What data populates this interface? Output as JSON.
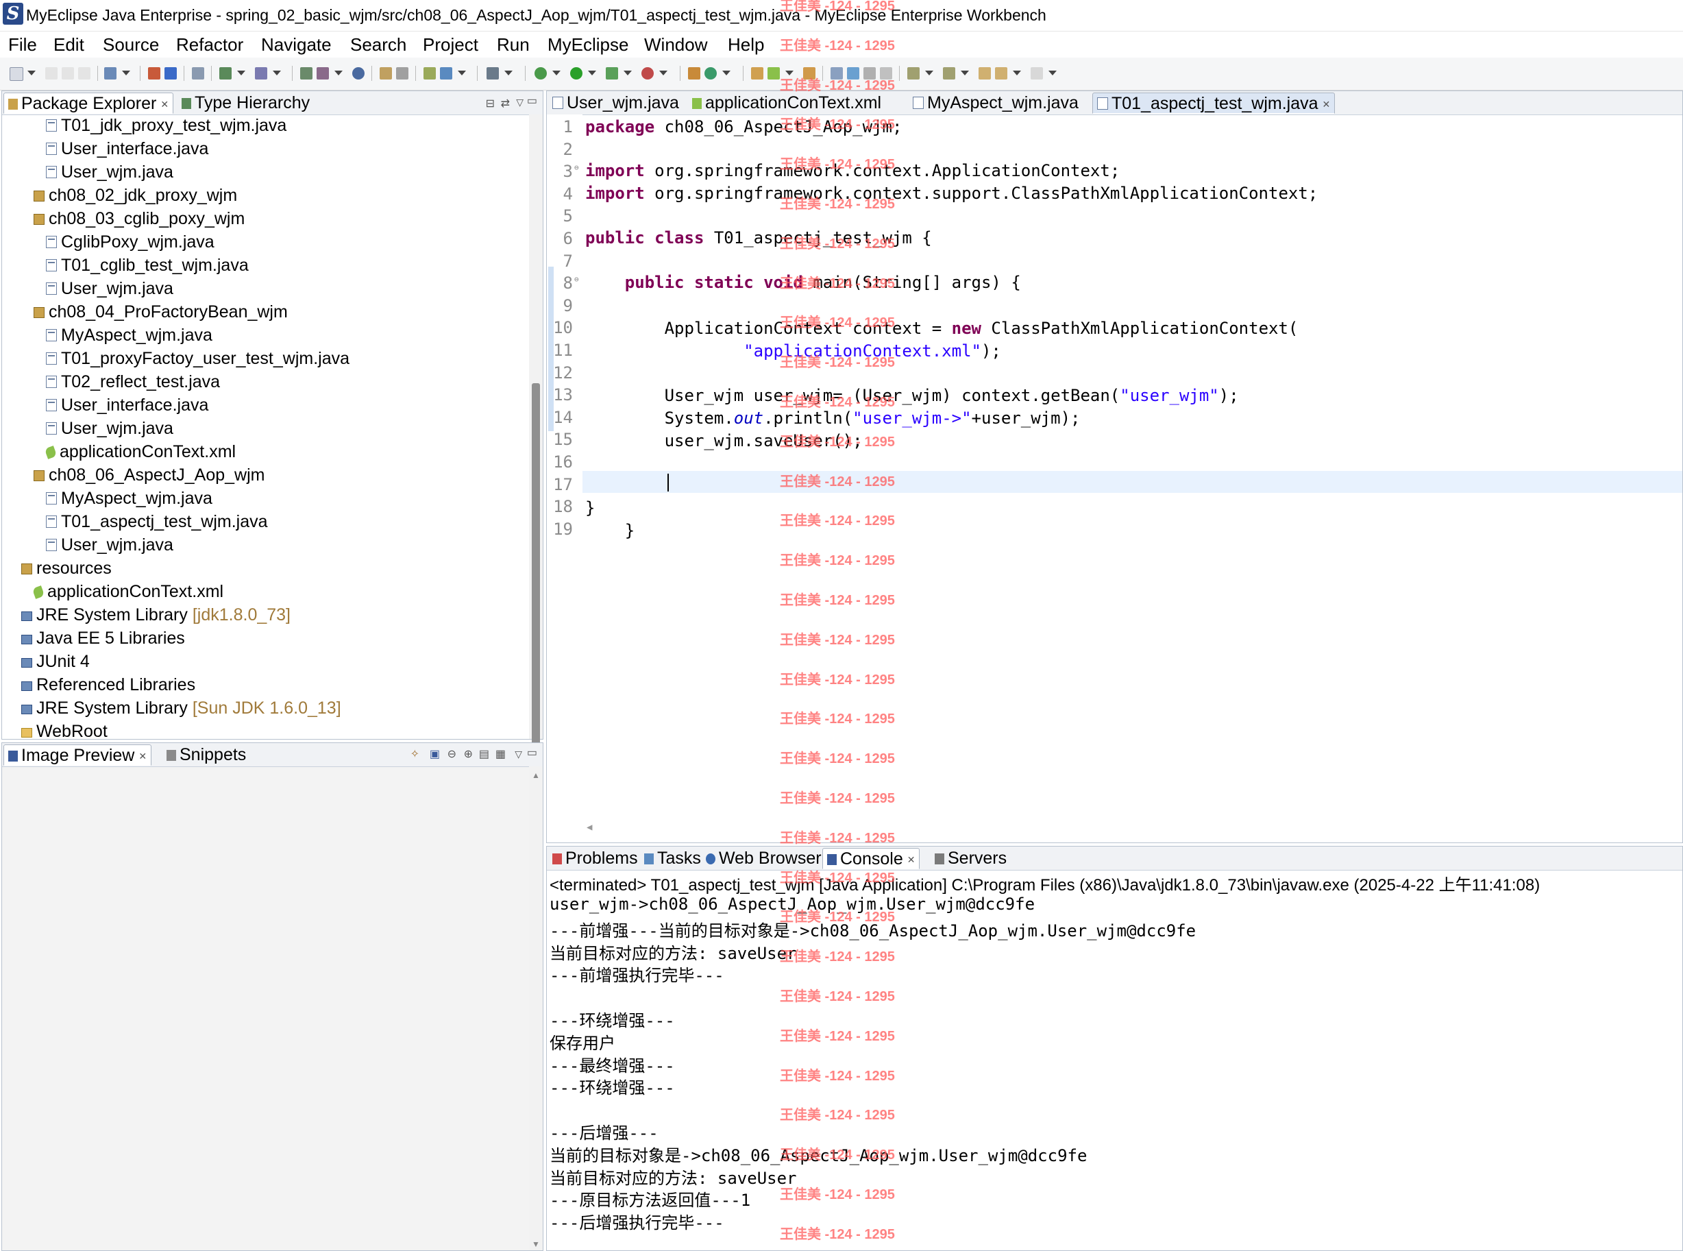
{
  "window": {
    "title": "MyEclipse Java Enterprise - spring_02_basic_wjm/src/ch08_06_AspectJ_Aop_wjm/T01_aspectj_test_wjm.java - MyEclipse Enterprise Workbench"
  },
  "menu": [
    "File",
    "Edit",
    "Source",
    "Refactor",
    "Navigate",
    "Search",
    "Project",
    "Run",
    "MyEclipse",
    "Window",
    "Help"
  ],
  "explorer": {
    "tabs": [
      "Package Explorer",
      "Type Hierarchy"
    ],
    "items": [
      {
        "label": "T01_jdk_proxy_test_wjm.java",
        "kind": "java-file-icon"
      },
      {
        "label": "User_interface.java",
        "kind": "java-file-icon"
      },
      {
        "label": "User_wjm.java",
        "kind": "java-file-icon"
      },
      {
        "label": "ch08_02_jdk_proxy_wjm",
        "kind": "package-icon"
      },
      {
        "label": "ch08_03_cglib_poxy_wjm",
        "kind": "package-icon"
      },
      {
        "label": "CglibPoxy_wjm.java",
        "kind": "java-file-icon"
      },
      {
        "label": "T01_cglib_test_wjm.java",
        "kind": "java-file-icon"
      },
      {
        "label": "User_wjm.java",
        "kind": "java-file-icon"
      },
      {
        "label": "ch08_04_ProFactoryBean_wjm",
        "kind": "package-icon"
      },
      {
        "label": "MyAspect_wjm.java",
        "kind": "java-file-icon"
      },
      {
        "label": "T01_proxyFactoy_user_test_wjm.java",
        "kind": "java-file-icon"
      },
      {
        "label": "T02_reflect_test.java",
        "kind": "java-file-icon"
      },
      {
        "label": "User_interface.java",
        "kind": "java-file-icon"
      },
      {
        "label": "User_wjm.java",
        "kind": "java-file-icon"
      },
      {
        "label": "applicationConText.xml",
        "kind": "xml-file-icon"
      },
      {
        "label": "ch08_06_AspectJ_Aop_wjm",
        "kind": "package-icon"
      },
      {
        "label": "MyAspect_wjm.java",
        "kind": "java-file-icon"
      },
      {
        "label": "T01_aspectj_test_wjm.java",
        "kind": "java-file-icon"
      },
      {
        "label": "User_wjm.java",
        "kind": "java-file-icon"
      },
      {
        "label": "resources",
        "kind": "package-icon"
      },
      {
        "label": "applicationConText.xml",
        "kind": "xml-file-icon"
      },
      {
        "label": "JRE System Library",
        "kind": "library-icon",
        "suffix": "[jdk1.8.0_73]"
      },
      {
        "label": "Java EE 5 Libraries",
        "kind": "library-icon"
      },
      {
        "label": "JUnit 4",
        "kind": "library-icon"
      },
      {
        "label": "Referenced Libraries",
        "kind": "library-icon"
      },
      {
        "label": "JRE System Library",
        "kind": "library-icon",
        "suffix": "[Sun JDK 1.6.0_13]"
      },
      {
        "label": "WebRoot",
        "kind": "folder-icon"
      }
    ]
  },
  "preview": {
    "tabs": [
      "Image Preview",
      "Snippets"
    ]
  },
  "editor": {
    "tabs": [
      "User_wjm.java",
      "applicationConText.xml",
      "MyAspect_wjm.java",
      "T01_aspectj_test_wjm.java"
    ],
    "active_tab": 3,
    "line_numbers": [
      "1",
      "2",
      "3",
      "4",
      "5",
      "6",
      "7",
      "8",
      "9",
      "10",
      "11",
      "12",
      "13",
      "14",
      "15",
      "16",
      "17",
      "18",
      "19"
    ],
    "code": {
      "l1_kw": "package",
      "l1": " ch08_06_AspectJ_Aop_wjm;",
      "l3_kw": "import",
      "l3": " org.springframework.context.ApplicationContext;",
      "l4_kw": "import",
      "l4": " org.springframework.context.support.ClassPathXmlApplicationContext;",
      "l6_kw": "public class",
      "l6": " T01_aspectj_test_wjm {",
      "l8_indent": "    ",
      "l8_kw": "public static void",
      "l8": " main(String[] args) {",
      "l10_indent": "        ",
      "l10a": "ApplicationContext context = ",
      "l10_kw": "new",
      "l10b": " ClassPathXmlApplicationContext(",
      "l11_indent": "                ",
      "l11_str": "\"applicationContext.xml\"",
      "l11": ");",
      "l13_indent": "        ",
      "l13a": "User_wjm user_wjm= (User_wjm) context.getBean(",
      "l13_str": "\"user_wjm\"",
      "l13b": ");",
      "l14_indent": "        ",
      "l14a": "System.",
      "l14_fld": "out",
      "l14b": ".println(",
      "l14_str": "\"user_wjm->\"",
      "l14c": "+user_wjm);",
      "l15_indent": "        ",
      "l15": "user_wjm.saveUser();",
      "l17": "}",
      "l18_indent": "    ",
      "l18": "}"
    }
  },
  "bottom": {
    "tabs": [
      "Problems",
      "Tasks",
      "Web Browser",
      "Console",
      "Servers"
    ],
    "active_tab": 3,
    "console_header": "<terminated> T01_aspectj_test_wjm [Java Application] C:\\Program Files (x86)\\Java\\jdk1.8.0_73\\bin\\javaw.exe (2025-4-22 上午11:41:08)",
    "lines": [
      "user_wjm->ch08_06_AspectJ_Aop_wjm.User_wjm@dcc9fe",
      "---前增强---当前的目标对象是->ch08_06_AspectJ_Aop_wjm.User_wjm@dcc9fe",
      "当前目标对应的方法: saveUser",
      "---前增强执行完毕---",
      "",
      "---环绕增强---",
      "保存用户",
      "---最终增强---",
      "---环绕增强---",
      "",
      "---后增强---",
      "当前的目标对象是->ch08_06_AspectJ_Aop_wjm.User_wjm@dcc9fe",
      "当前目标对应的方法: saveUser",
      "---原目标方法返回值---1",
      "---后增强执行完毕---"
    ]
  },
  "watermark": "王佳美 -124 - 1295",
  "colors": {
    "keyword": "#7f0055",
    "string": "#2a00ff",
    "field": "#0000c0",
    "watermark": "#ff5a5a",
    "library_version": "#a07a3a"
  }
}
